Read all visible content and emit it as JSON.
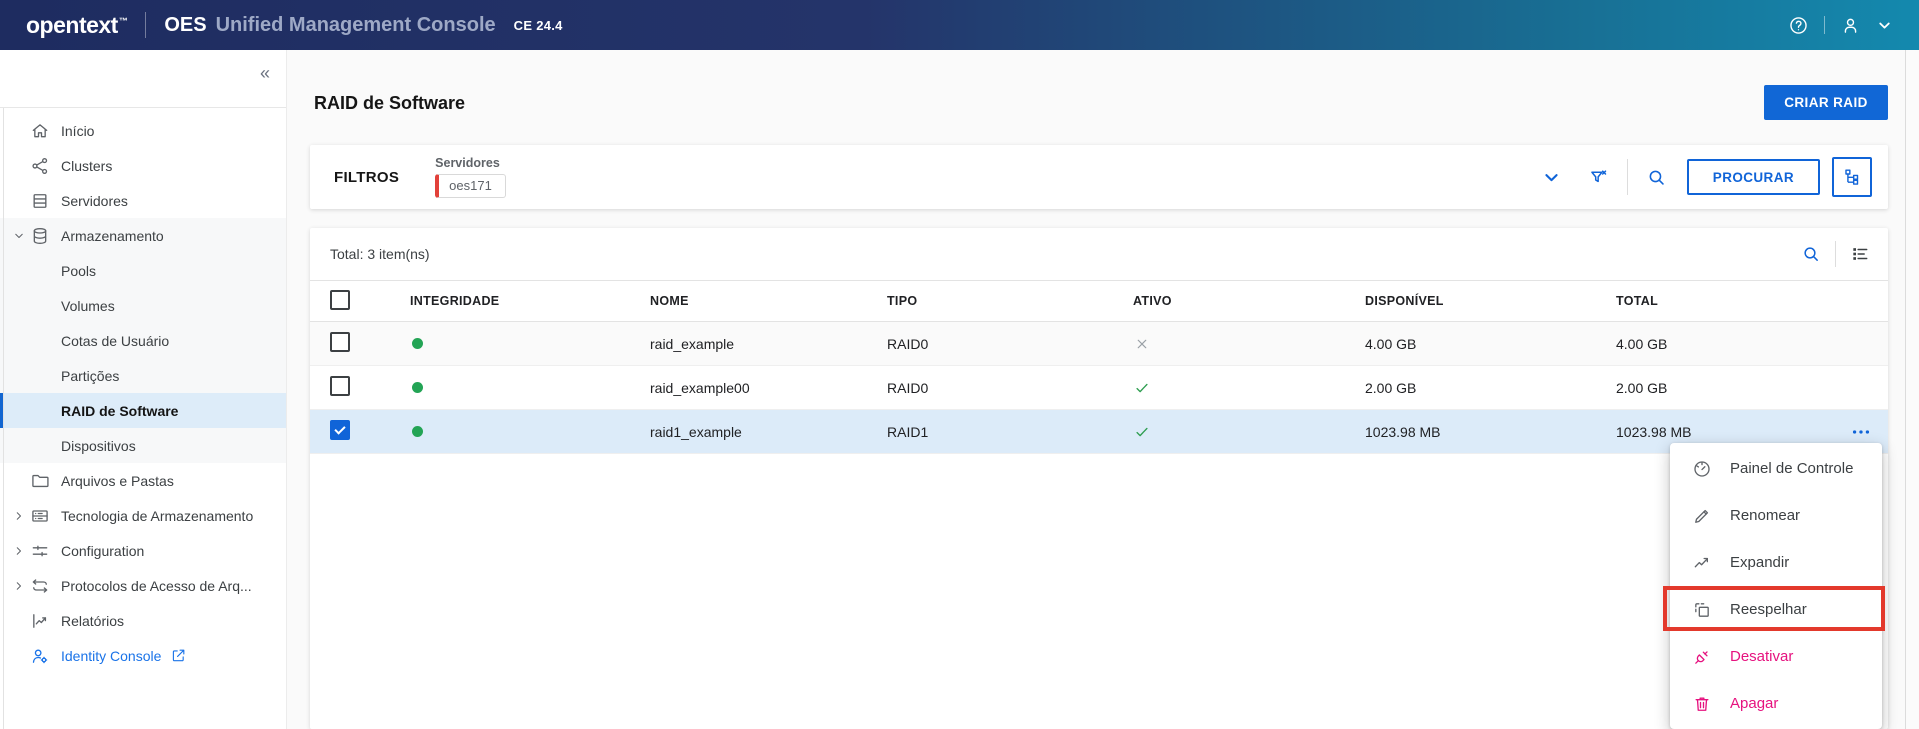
{
  "header": {
    "logo_text": "opentext",
    "trademark": "™",
    "product": "OES",
    "product_name": "Unified Management Console",
    "version_badge": "CE 24.4"
  },
  "sidebar": {
    "collapse_icon": "«",
    "items": [
      {
        "id": "inicio",
        "label": "Início",
        "icon": "home"
      },
      {
        "id": "clusters",
        "label": "Clusters",
        "icon": "clusters"
      },
      {
        "id": "servidores",
        "label": "Servidores",
        "icon": "servers"
      },
      {
        "id": "armazenamento",
        "label": "Armazenamento",
        "icon": "storage",
        "chevron": "down",
        "group": true
      },
      {
        "id": "pools",
        "label": "Pools",
        "group": true,
        "child": true
      },
      {
        "id": "volumes",
        "label": "Volumes",
        "group": true,
        "child": true
      },
      {
        "id": "cotas-de-usuario",
        "label": "Cotas de Usuário",
        "group": true,
        "child": true
      },
      {
        "id": "particoes",
        "label": "Partições",
        "group": true,
        "child": true
      },
      {
        "id": "raid-de-software",
        "label": "RAID de Software",
        "group": true,
        "child": true,
        "selected": true
      },
      {
        "id": "dispositivos",
        "label": "Dispositivos",
        "group": true,
        "child": true
      },
      {
        "id": "arquivos-e-pastas",
        "label": "Arquivos e Pastas",
        "icon": "folder"
      },
      {
        "id": "tecnologia-de-armazenamento",
        "label": "Tecnologia de Armazenamento",
        "icon": "tech",
        "chevron": "right"
      },
      {
        "id": "configuration",
        "label": "Configuration",
        "icon": "sliders",
        "chevron": "right"
      },
      {
        "id": "protocolos-de-acesso",
        "label": "Protocolos de Acesso de Arq...",
        "icon": "protocols",
        "chevron": "right"
      },
      {
        "id": "relatorios",
        "label": "Relatórios",
        "icon": "reports"
      },
      {
        "id": "identity-console",
        "label": "Identity Console",
        "icon": "identity",
        "external": true,
        "link": true
      }
    ]
  },
  "page": {
    "title": "RAID de Software",
    "create_button": "CRIAR RAID"
  },
  "filters": {
    "title": "FILTROS",
    "group_label": "Servidores",
    "chip_value": "oes171",
    "search_button": "PROCURAR"
  },
  "table": {
    "total_label": "Total: 3 item(ns)",
    "columns": [
      "INTEGRIDADE",
      "NOME",
      "TIPO",
      "ATIVO",
      "DISPONÍVEL",
      "TOTAL"
    ],
    "rows": [
      {
        "name": "raid_example",
        "type": "RAID0",
        "health": "good",
        "active": false,
        "available": "4.00 GB",
        "total": "4.00 GB",
        "checked": false
      },
      {
        "name": "raid_example00",
        "type": "RAID0",
        "health": "good",
        "active": true,
        "available": "2.00 GB",
        "total": "2.00 GB",
        "checked": false
      },
      {
        "name": "raid1_example",
        "type": "RAID1",
        "health": "good",
        "active": true,
        "available": "1023.98 MB",
        "total": "1023.98 MB",
        "checked": true,
        "menu_open": true
      }
    ]
  },
  "context_menu": {
    "items": [
      {
        "label": "Painel de Controle",
        "icon": "gauge"
      },
      {
        "label": "Renomear",
        "icon": "pencil"
      },
      {
        "label": "Expandir",
        "icon": "trend"
      },
      {
        "label": "Reespelhar",
        "icon": "remirror",
        "annotated": true
      },
      {
        "label": "Desativar",
        "icon": "unplug",
        "danger": true
      },
      {
        "label": "Apagar",
        "icon": "trash",
        "danger": true
      }
    ]
  },
  "colors": {
    "accent_blue": "#1064d8",
    "header_navy": "#1e2c60",
    "header_teal": "#1489ae",
    "selected_row": "#dcebf9",
    "sidebar_selected": "#ddecf9",
    "health_green": "#23a455",
    "danger_pink": "#e6127f",
    "annotation_red": "#e3392c",
    "chip_red": "#e2413a"
  }
}
